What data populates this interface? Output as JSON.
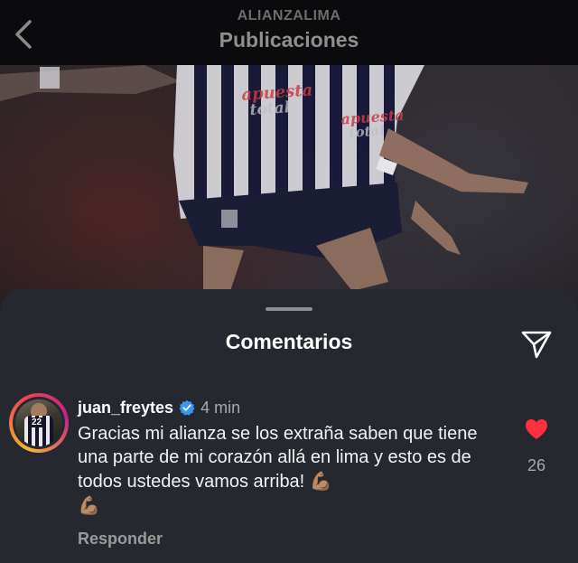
{
  "header": {
    "account": "ALIANZALIMA",
    "title": "Publicaciones",
    "back_icon": "chevron-left-icon"
  },
  "post_photo": {
    "sponsor_top_1": "apuesta",
    "sponsor_bottom_1": "total",
    "sponsor_top_2": "apuesta",
    "sponsor_bottom_2": "total"
  },
  "comments_sheet": {
    "title": "Comentarios",
    "share_icon": "paper-plane-icon"
  },
  "comment": {
    "username": "juan_freytes",
    "verified": true,
    "time": "4 min",
    "avatar_number": "22",
    "text": "Gracias mi alianza se los extraña saben que tiene una parte de mi corazón allá en lima y esto es de todos ustedes vamos arriba!",
    "emoji_1": "💪🏽",
    "emoji_2": "💪🏽",
    "like_count": "26",
    "liked": true,
    "reply_label": "Responder"
  },
  "colors": {
    "sheet_bg": "#25282e",
    "like_red": "#ff3040",
    "verified_blue": "#3897f0"
  }
}
